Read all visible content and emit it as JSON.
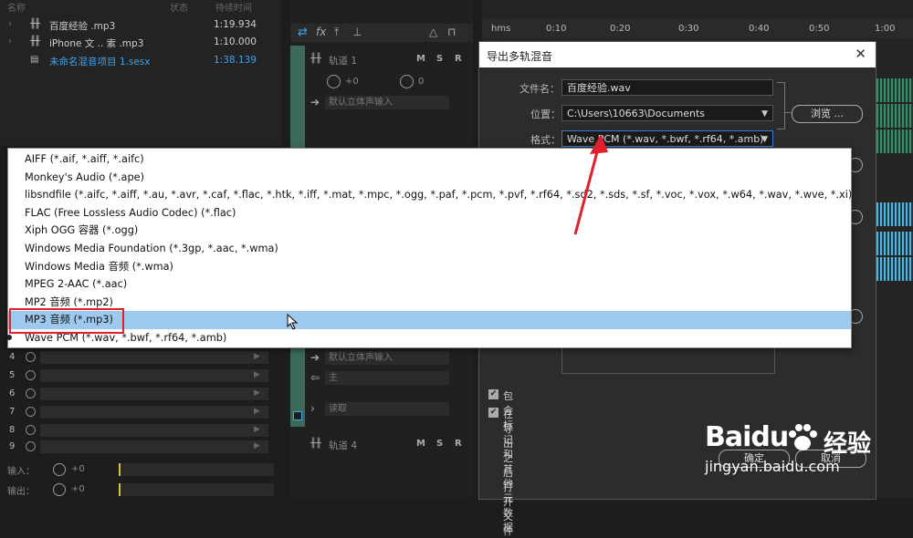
{
  "files": {
    "header_name": "名称",
    "header_status": "状态",
    "header_duration": "持续时间",
    "items": [
      {
        "name": "百度经验 .mp3",
        "duration": "1:19.934"
      },
      {
        "name": "iPhone 文 .. 索 .mp3",
        "duration": "1:10.000"
      },
      {
        "name": "未命名混音项目 1.sesx",
        "duration": "1:38.139"
      }
    ]
  },
  "tracks": [
    {
      "name": "轨道 1",
      "m": "M",
      "s": "S",
      "r": "R",
      "vol": "+0",
      "pan": "0",
      "input": "默认立体声输入"
    },
    {
      "name": "轨道 4",
      "m": "M",
      "s": "S",
      "r": "R",
      "input": "默认立体声输入",
      "output": "主",
      "read": "读取"
    }
  ],
  "timeline": {
    "ticks": [
      "hms",
      "0:10",
      "0:20",
      "0:30",
      "0:40",
      "0:50",
      "1:00"
    ],
    "wave_color_green": "#3a8c6a",
    "wave_color_blue": "#5ab3d8"
  },
  "mixer": {
    "channels": [
      "4",
      "5",
      "6",
      "7",
      "8",
      "9"
    ],
    "input_label": "输入：",
    "output_label": "输出：",
    "vol": "+0"
  },
  "dialog": {
    "title": "导出多轨混音",
    "filename_label": "文件名：",
    "filename_value": "百度经验.wav",
    "location_label": "位置：",
    "location_value": "C:\\Users\\10663\\Documents",
    "browse_label": "浏览 ...",
    "format_label": "格式：",
    "format_value": "Wave PCM (*.wav, *.bwf, *.rf64, *.amb)",
    "include_markers_label": "包含标记和其他元数据",
    "open_after_export_label": "在导出之后打开文件",
    "ok_label": "确定",
    "cancel_label": "取消"
  },
  "format_options": [
    "AIFF (*.aif, *.aiff, *.aifc)",
    "Monkey's Audio (*.ape)",
    "libsndfile (*.aifc, *.aiff, *.au, *.avr, *.caf, *.flac, *.htk, *.iff, *.mat, *.mpc, *.ogg, *.paf, *.pcm, *.pvf, *.rf64, *.sd2, *.sds, *.sf, *.voc, *.vox, *.w64, *.wav, *.wve, *.xi)",
    "FLAC (Free Lossless Audio Codec) (*.flac)",
    "Xiph OGG 容器 (*.ogg)",
    "Windows Media Foundation (*.3gp, *.aac, *.wma)",
    "Windows Media 音频 (*.wma)",
    "MPEG 2-AAC (*.aac)",
    "MP2 音频 (*.mp2)",
    "MP3 音频 (*.mp3)",
    "Wave PCM (*.wav, *.bwf, *.rf64, *.amb)"
  ],
  "highlighted_option": "MP3 音频 (*.mp3)",
  "watermark": {
    "brand": "Baidu",
    "brand_cn": "经验",
    "site": "jingyan.baidu.com"
  },
  "colors": {
    "accent_blue": "#3aa4f0",
    "highlight": "#9ec9ee",
    "annotation_red": "#e0202a"
  }
}
